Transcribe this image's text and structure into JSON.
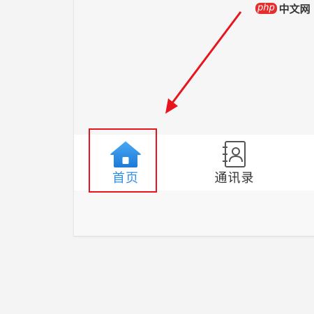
{
  "watermark": {
    "logo": "php",
    "text": "中文网"
  },
  "tab_bar": {
    "tabs": [
      {
        "label": "首页",
        "icon": "home-icon",
        "active": true
      },
      {
        "label": "通讯录",
        "icon": "contacts-icon",
        "active": false
      }
    ]
  },
  "colors": {
    "active": "#2f8fe6",
    "inactive": "#333333",
    "annotation": "#e6151e"
  }
}
